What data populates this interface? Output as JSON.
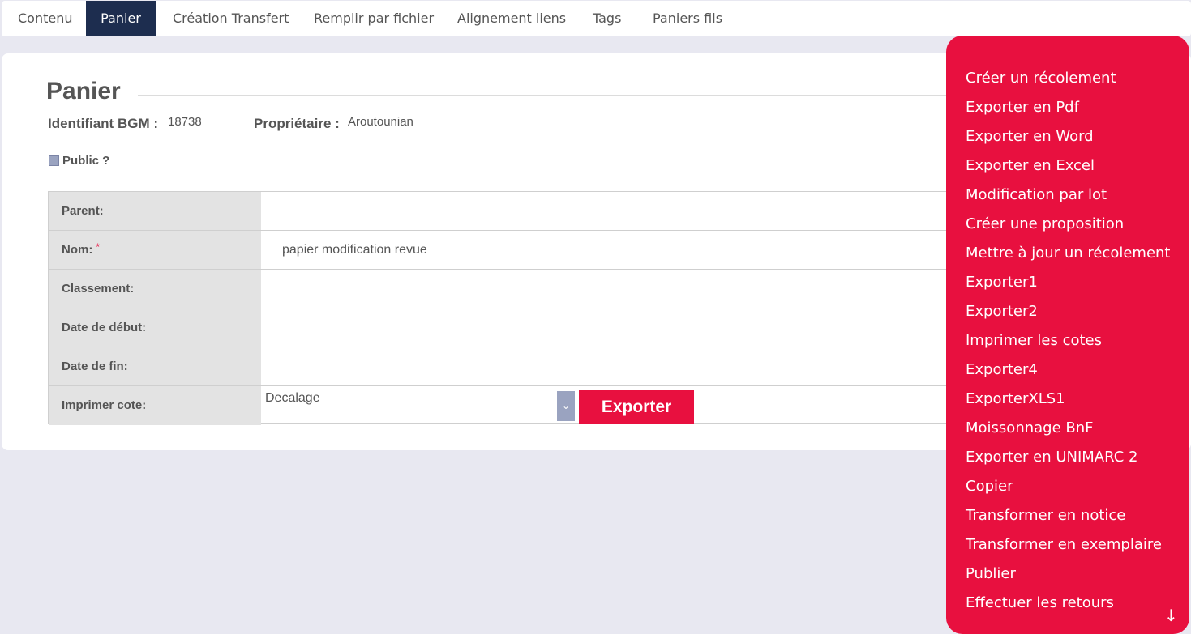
{
  "tabs": [
    {
      "label": "Contenu",
      "active": false
    },
    {
      "label": "Panier",
      "active": true
    },
    {
      "label": "Création Transfert",
      "active": false
    },
    {
      "label": "Remplir par fichier",
      "active": false
    },
    {
      "label": "Alignement liens",
      "active": false
    },
    {
      "label": "Tags",
      "active": false
    },
    {
      "label": "Paniers fils",
      "active": false
    }
  ],
  "page": {
    "title": "Panier",
    "id_label": "Identifiant BGM :",
    "id_value": "18738",
    "owner_label": "Propriétaire :",
    "owner_value": "Aroutounian",
    "public_label": "Public ?"
  },
  "form": {
    "rows": [
      {
        "label": "Parent:",
        "value": ""
      },
      {
        "label": "Nom:",
        "required_mark": "*",
        "value": "papier modification revue"
      },
      {
        "label": "Classement:",
        "value": ""
      },
      {
        "label": "Date de début:",
        "value": ""
      },
      {
        "label": "Date de fin:",
        "value": ""
      },
      {
        "label": "Imprimer cote:",
        "select_value": "Decalage",
        "button": "Exporter"
      }
    ]
  },
  "menu": {
    "items": [
      "Créer un récolement",
      "Exporter en Pdf",
      "Exporter en Word",
      "Exporter en Excel",
      "Modification par lot",
      "Créer une proposition",
      "Mettre à jour un récolement",
      "Exporter1",
      "Exporter2",
      "Imprimer les cotes",
      "Exporter4",
      "ExporterXLS1",
      "Moissonnage BnF",
      "Exporter en UNIMARC 2",
      "Copier",
      "Transformer en notice",
      "Transformer en exemplaire",
      "Publier",
      "Effectuer les retours"
    ],
    "scroll_icon": "arrow-down-icon"
  },
  "colors": {
    "accent": "#e8103f",
    "active_tab": "#1d2d4f",
    "background": "#e8e8f1"
  }
}
